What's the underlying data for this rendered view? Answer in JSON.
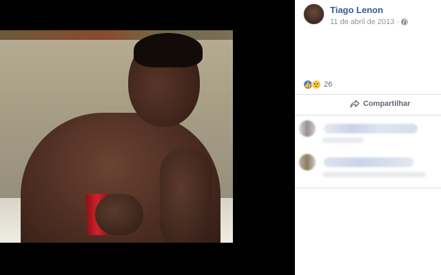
{
  "post": {
    "author_name": "Tiago Lenon",
    "date": "11 de abril de 2013",
    "date_sep": "·",
    "reaction_count": "26",
    "share_label": "Compartilhar",
    "privacy_icon": "globe-icon",
    "reactions": [
      "like-icon",
      "sad-icon"
    ]
  },
  "colors": {
    "author": "#385898",
    "meta": "#90949c",
    "like": "#4a7bd8"
  }
}
